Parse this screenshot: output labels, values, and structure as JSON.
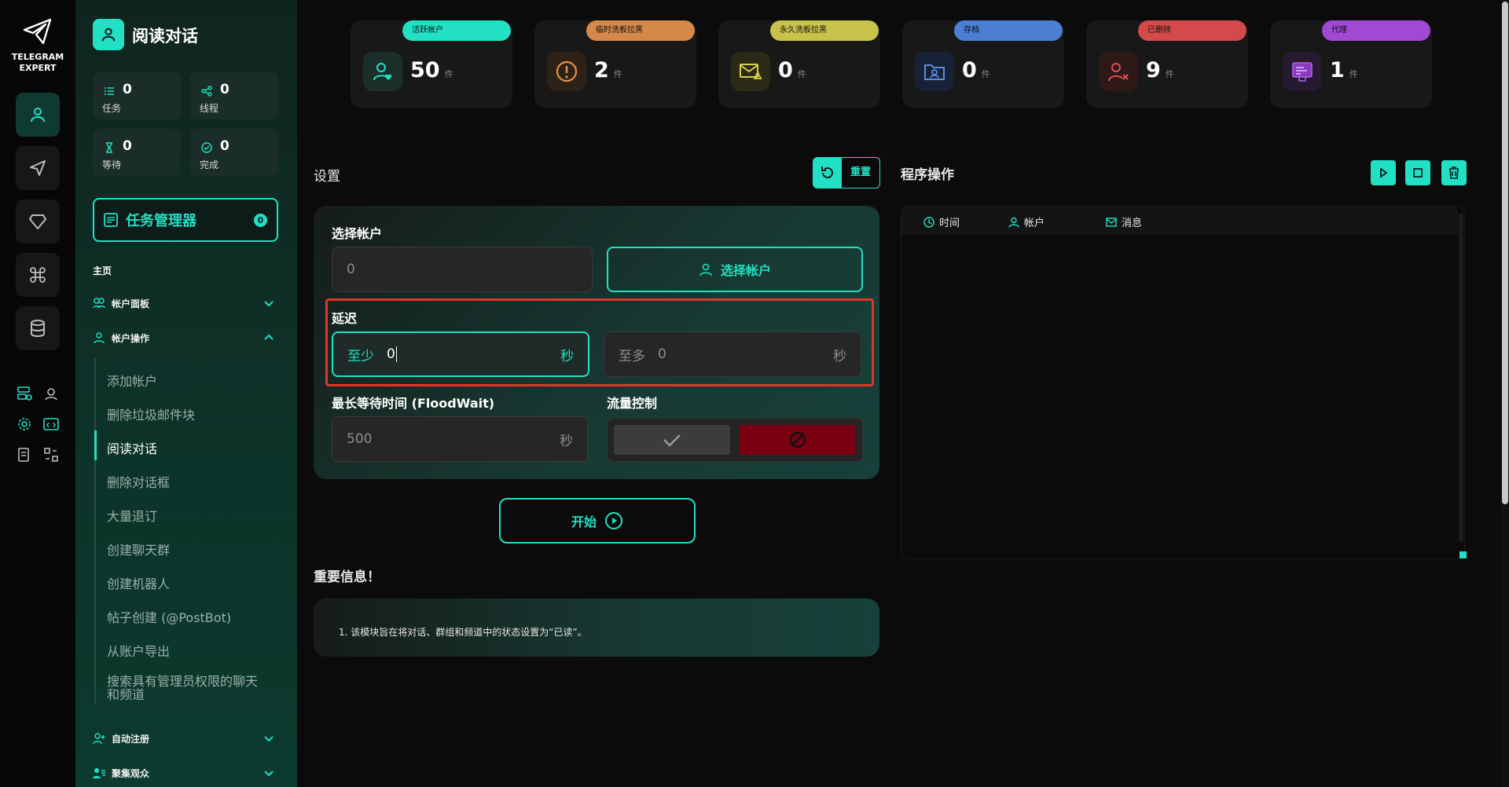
{
  "app": {
    "logo_line1": "TELEGRAM",
    "logo_line2": "EXPERT",
    "section_title": "阅读对话"
  },
  "sidebar_stats": [
    {
      "value": "0",
      "label": "任务"
    },
    {
      "value": "0",
      "label": "线程"
    },
    {
      "value": "0",
      "label": "等待"
    },
    {
      "value": "0",
      "label": "完成"
    }
  ],
  "task_manager": {
    "label": "任务管理器",
    "count": "0"
  },
  "nav": {
    "home_label": "主页",
    "account_panel": "帐户面板",
    "account_ops": "帐户操作",
    "sub_items": [
      "添加帐户",
      "删除垃圾邮件块",
      "阅读对话",
      "删除对话框",
      "大量退订",
      "创建聊天群",
      "创建机器人",
      "帖子创建 (@PostBot)",
      "从账户导出",
      "搜索具有管理员权限的聊天",
      "和频道"
    ],
    "auto_register": "自动注册",
    "audience": "聚集观众"
  },
  "top_cards": [
    {
      "badge": "活跃帐户",
      "value": "50",
      "unit": "件",
      "color": "#22e0c4",
      "icon": "user-heart-icon"
    },
    {
      "badge": "临时洗板拉黑",
      "value": "2",
      "unit": "件",
      "color": "#d4884a",
      "icon": "warning-icon"
    },
    {
      "badge": "永久洗板拉黑",
      "value": "0",
      "unit": "件",
      "color": "#c9c24a",
      "icon": "mail-block-icon"
    },
    {
      "badge": "存档",
      "value": "0",
      "unit": "件",
      "color": "#4a7fd4",
      "icon": "folder-user-icon"
    },
    {
      "badge": "已删除",
      "value": "9",
      "unit": "件",
      "color": "#d44a4a",
      "icon": "user-x-icon"
    },
    {
      "badge": "代理",
      "value": "1",
      "unit": "件",
      "color": "#a04ad4",
      "icon": "proxy-icon"
    }
  ],
  "settings": {
    "title": "设置",
    "reset_label": "重置",
    "account_label": "选择帐户",
    "account_placeholder": "0",
    "select_account_btn": "选择帐户",
    "delay_label": "延迟",
    "min_prefix": "至少",
    "min_value": "0",
    "max_prefix": "至多",
    "max_placeholder": "0",
    "unit_sec": "秒",
    "floodwait_label": "最长等待时间 (FloodWait)",
    "floodwait_placeholder": "500",
    "flow_label": "流量控制",
    "start_label": "开始"
  },
  "info": {
    "title": "重要信息！",
    "text": "1. 该模块旨在将对话、群组和频道中的状态设置为“已读”。"
  },
  "ops": {
    "title": "程序操作",
    "col_time": "时间",
    "col_account": "帐户",
    "col_message": "消息"
  }
}
